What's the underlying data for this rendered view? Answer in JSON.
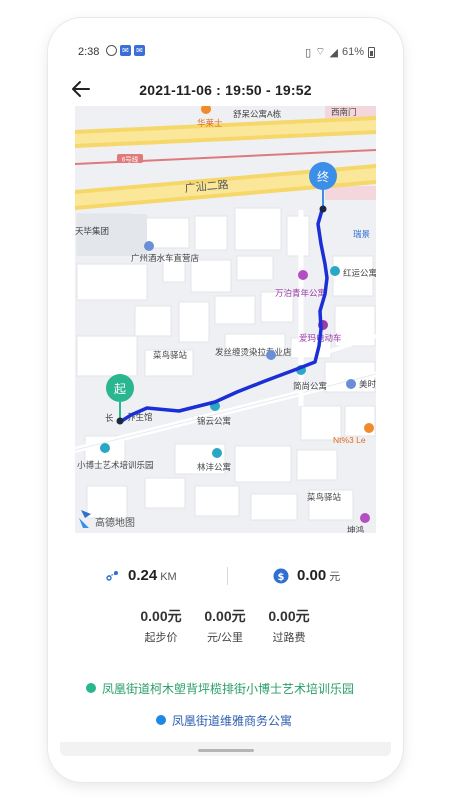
{
  "status_bar": {
    "time": "2:38",
    "battery": "61%"
  },
  "header": {
    "back_icon": "arrow-left-icon",
    "title": "2021-11-06 : 19:50 - 19:52"
  },
  "map": {
    "road_labels": [
      "广汕二路",
      "6号线"
    ],
    "poi_labels": [
      "华莱士",
      "舒呆公寓A栋",
      "西南门",
      "天毕集团",
      "瑞景",
      "广州酒水车直营店",
      "红运公寓",
      "万泊青年公寓",
      "爱玛电动车",
      "菜鸟驿站",
      "发丝缠烫染拉专业店",
      "简尚公寓",
      "美时",
      "锦云公寓",
      "长",
      "养生馆",
      "Nt%3 Le",
      "小博士艺术培训乐园",
      "林沣公寓",
      "菜鸟驿站",
      "坤鸿"
    ],
    "start_marker": "起",
    "end_marker": "终",
    "logo_text": "高德地图",
    "route_color": "#1a2fd6",
    "start_color": "#2ab68f",
    "end_color": "#3b8fe8"
  },
  "stats": {
    "distance_value": "0.24",
    "distance_unit": "KM",
    "fee_value": "0.00",
    "fee_unit": "元"
  },
  "fees": [
    {
      "value": "0.00元",
      "label": "起步价"
    },
    {
      "value": "0.00元",
      "label": "元/公里"
    },
    {
      "value": "0.00元",
      "label": "过路费"
    }
  ],
  "addresses": {
    "start": "凤凰街道柯木塱背坪榄排街小博士艺术培训乐园",
    "end": "凤凰街道维雅商务公寓",
    "start_color": "#2ab68f",
    "end_color": "#1e88e5"
  }
}
